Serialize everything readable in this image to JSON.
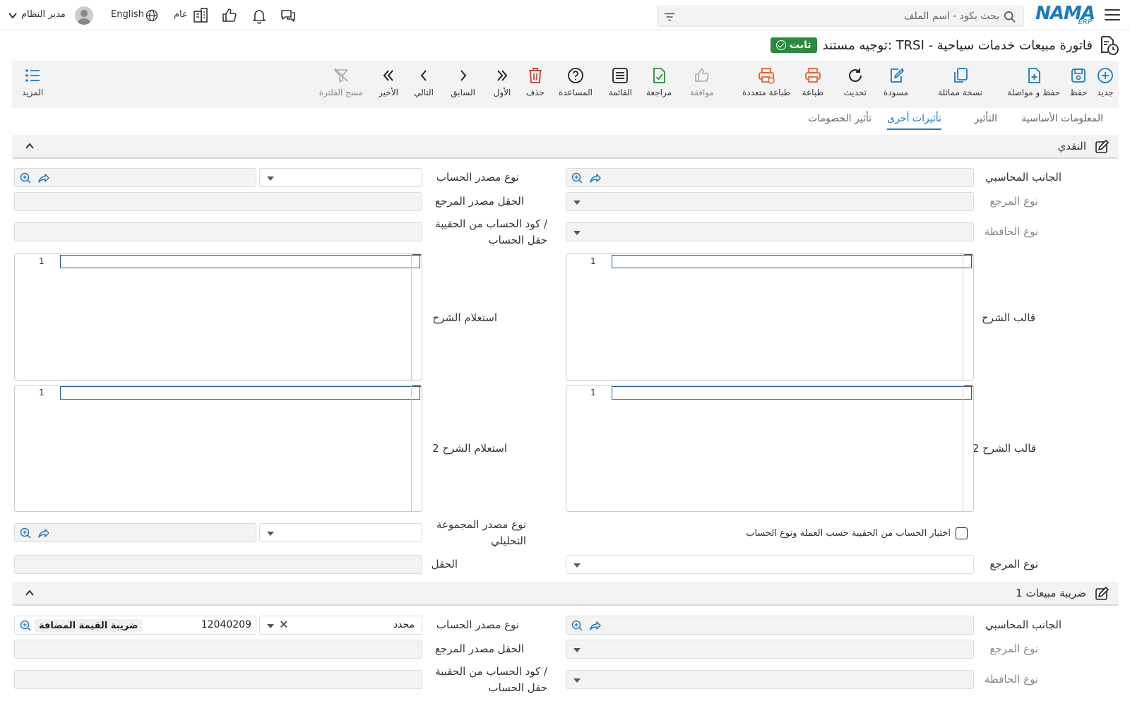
{
  "app": {
    "logo_text": "NAMA",
    "logo_sub": "ERP"
  },
  "topbar": {
    "search_placeholder": "بحث بكود - اسم الملف",
    "language": "English",
    "branch": "عام",
    "user": "مدير النظام"
  },
  "document": {
    "title": "توجيه مستند: TRSI - فاتورة مبيعات خدمات سياحية",
    "status": "ثابت",
    "status_color": "#2a8a3e"
  },
  "toolbar": {
    "new": "جديد",
    "save": "حفظ",
    "save_continue": "حفظ و مواصلة",
    "duplicate": "نسخة مماثلة",
    "draft": "مسودة",
    "refresh": "تحديث",
    "print": "طباعة",
    "multi_print": "طباعة متعددة",
    "approve": "موافقة",
    "review": "مراجعة",
    "list": "القائمة",
    "help": "المساعدة",
    "delete": "حذف",
    "first": "الأول",
    "previous": "السابق",
    "next": "التالي",
    "last": "الأخير",
    "clear_filter": "مسح الفلترة",
    "more": "المزيد"
  },
  "tabs": [
    "المعلومات الأساسية",
    "التأثير",
    "تأثيرات أخرى",
    "تأثير الخصومات"
  ],
  "active_tab": "تأثيرات أخرى",
  "section_cash": {
    "title": "النقدي",
    "accounting_side": "الجانب المحاسبي",
    "account_source_type": "نوع مصدر الحساب",
    "ref_type": "نوع المرجع",
    "ref_source_field": "الحقل مصدر المرجع",
    "portfolio_type": "نوع الحافظة",
    "account_code_line1": "كود الحساب من الحقيبة /",
    "account_code_line2": "حقل الحساب",
    "narration_template": "قالب الشرح",
    "narration_query": "استعلام الشرح",
    "narration_template2": "قالب الشرح 2",
    "narration_query2": "استعلام الشرح 2",
    "line_number": "1",
    "portfolio_checkbox": "اختيار الحساب من الحقيبة حسب العملة ونوع الحساب",
    "analytic_group_line1": "نوع مصدر المجموعة",
    "analytic_group_line2": "التحليلي",
    "ref_type2": "نوع المرجع",
    "field": "الحقل"
  },
  "section_tax": {
    "title": "ضريبة مبيعات 1",
    "accounting_side": "الجانب المحاسبي",
    "account_source_type": "نوع مصدر الحساب",
    "account_source_value": "محدد",
    "account_code": "12040209",
    "account_name": "ضريبة القيمة المضافة",
    "ref_type": "نوع المرجع",
    "ref_source_field": "الحقل مصدر المرجع",
    "portfolio_type": "نوع الحافظة",
    "account_code_line1": "كود الحساب من الحقيبة /",
    "account_code_line2": "حقل الحساب"
  }
}
